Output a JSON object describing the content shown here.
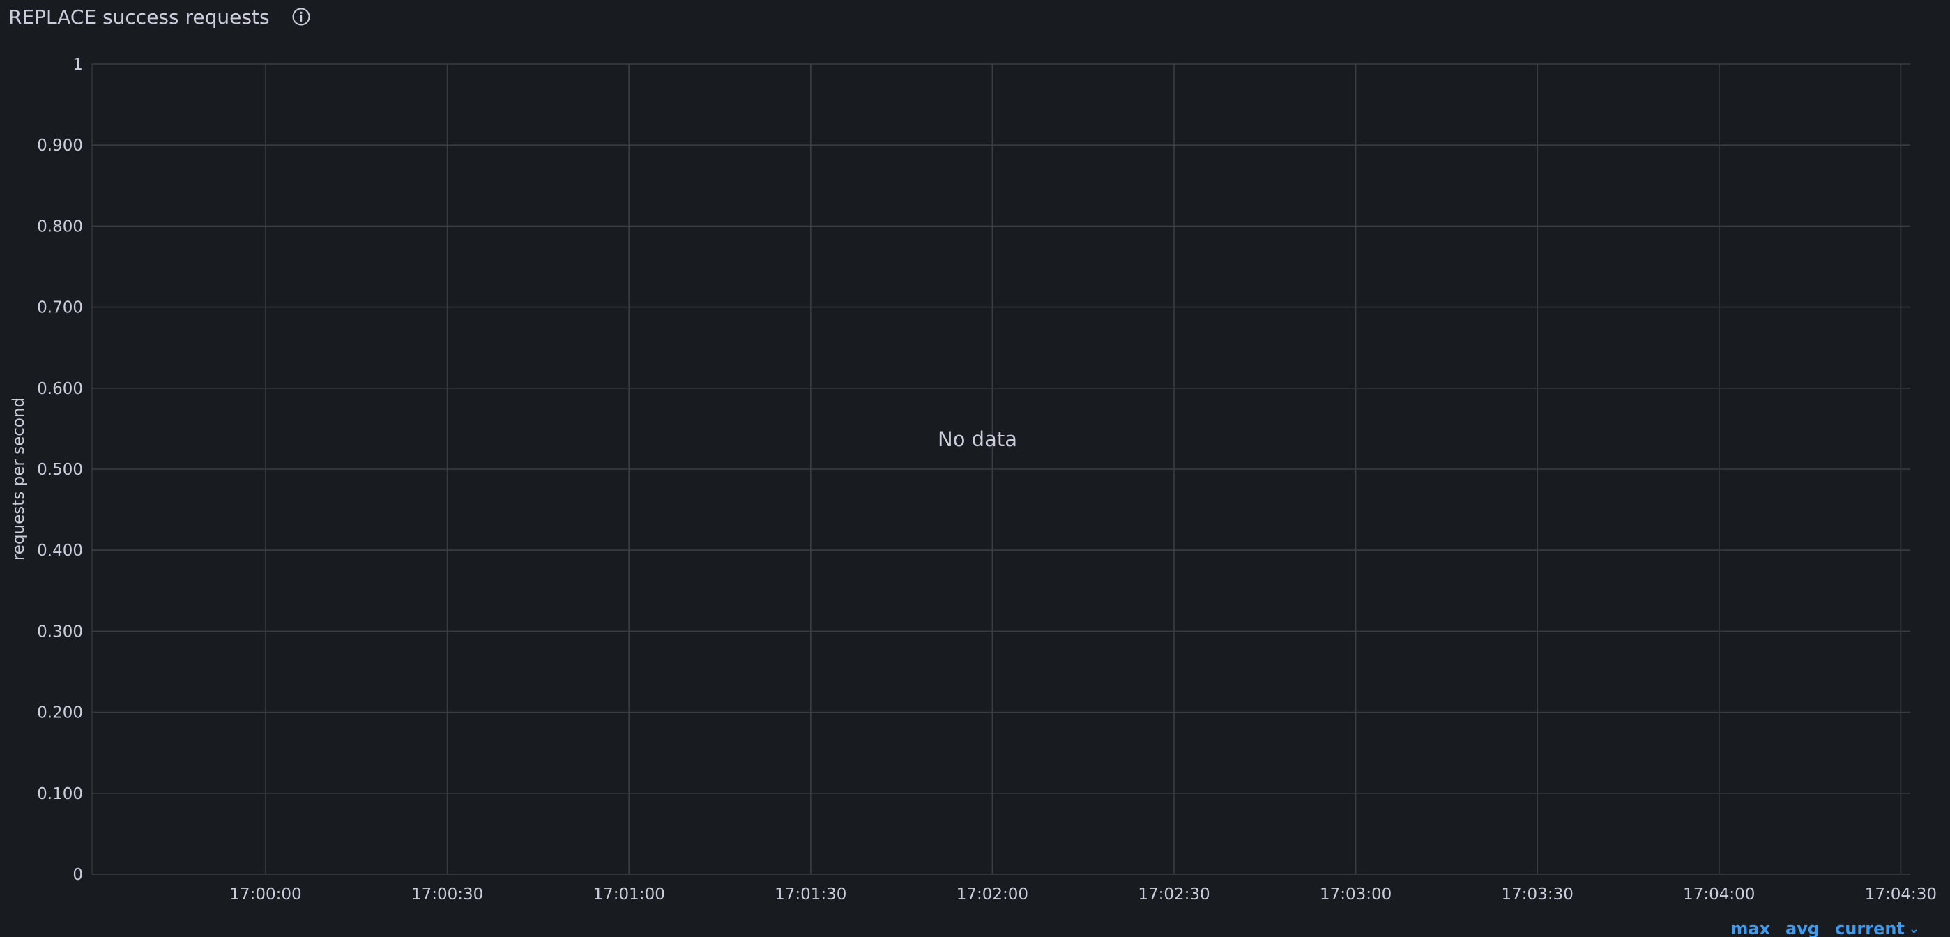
{
  "panel": {
    "title": "REPLACE success requests",
    "info_icon": "info-circle-icon"
  },
  "no_data_text": "No data",
  "legend": {
    "max_label": "max",
    "avg_label": "avg",
    "current_label": "current",
    "current_icon": "chevron-down-icon"
  },
  "colors": {
    "background": "#181b1f",
    "grid": "#3a3d44",
    "text": "#ccccdc",
    "accent": "#3d9cf0"
  },
  "chart_data": {
    "type": "line",
    "title": "REPLACE success requests",
    "xlabel": "",
    "ylabel": "requests per second",
    "series": [],
    "ylim": [
      0,
      1
    ],
    "y_ticks": [
      "0",
      "0.100",
      "0.200",
      "0.300",
      "0.400",
      "0.500",
      "0.600",
      "0.700",
      "0.800",
      "0.900",
      "1"
    ],
    "x_ticks": [
      "17:00:00",
      "17:00:30",
      "17:01:00",
      "17:01:30",
      "17:02:00",
      "17:02:30",
      "17:03:00",
      "17:03:30",
      "17:04:00",
      "17:04:30"
    ],
    "grid": true,
    "legend": "bottom-right"
  }
}
